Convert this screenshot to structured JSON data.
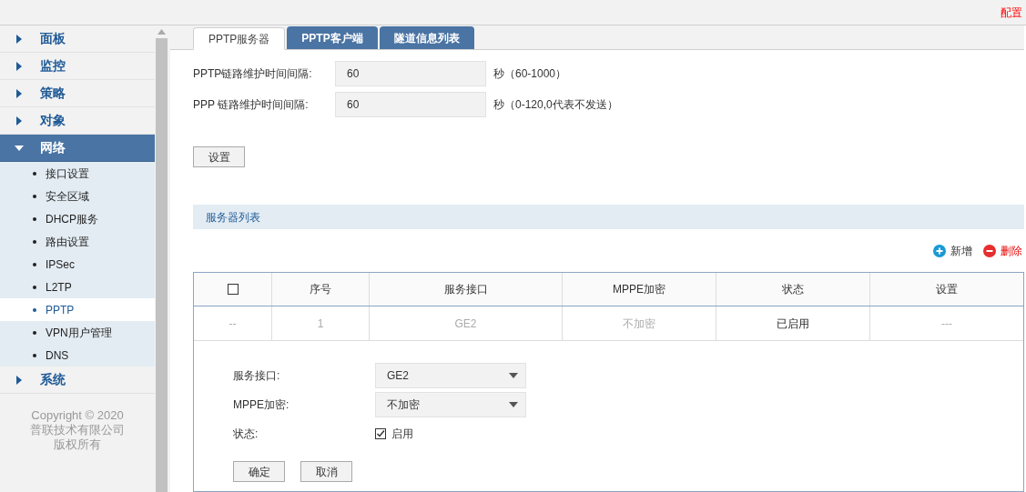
{
  "top_bar": {
    "link": "配置"
  },
  "sidebar": {
    "items": [
      {
        "label": "面板",
        "expanded": false
      },
      {
        "label": "监控",
        "expanded": false
      },
      {
        "label": "策略",
        "expanded": false
      },
      {
        "label": "对象",
        "expanded": false
      },
      {
        "label": "网络",
        "expanded": true,
        "children": [
          {
            "label": "接口设置",
            "selected": false
          },
          {
            "label": "安全区域",
            "selected": false
          },
          {
            "label": "DHCP服务",
            "selected": false
          },
          {
            "label": "路由设置",
            "selected": false
          },
          {
            "label": "IPSec",
            "selected": false
          },
          {
            "label": "L2TP",
            "selected": false
          },
          {
            "label": "PPTP",
            "selected": true
          },
          {
            "label": "VPN用户管理",
            "selected": false
          },
          {
            "label": "DNS",
            "selected": false
          }
        ]
      },
      {
        "label": "系统",
        "expanded": false
      }
    ],
    "copyright": [
      "Copyright © 2020",
      "普联技术有限公司",
      "版权所有"
    ]
  },
  "tabs": [
    {
      "label": "PPTP服务器",
      "selected": true
    },
    {
      "label": "PPTP客户端",
      "selected": false
    },
    {
      "label": "隧道信息列表",
      "selected": false
    }
  ],
  "settings": {
    "fields": [
      {
        "label": "PPTP链路维护时间间隔:",
        "value": "60",
        "hint": "秒（60-1000）"
      },
      {
        "label": "PPP 链路维护时间间隔:",
        "value": "60",
        "hint": "秒（0-120,0代表不发送）"
      }
    ],
    "button": "设置"
  },
  "server_list": {
    "title": "服务器列表",
    "add": "新增",
    "delete": "删除",
    "columns": [
      {
        "kind": "checkbox",
        "checked": false
      },
      {
        "kind": "text",
        "label": "序号"
      },
      {
        "kind": "text",
        "label": "服务接口"
      },
      {
        "kind": "text",
        "label": "MPPE加密"
      },
      {
        "kind": "text",
        "label": "状态"
      },
      {
        "kind": "text",
        "label": "设置"
      }
    ],
    "rows": [
      {
        "cells": [
          "--",
          "1",
          "GE2",
          "不加密",
          "已启用",
          "---"
        ]
      }
    ],
    "editor": {
      "fields": [
        {
          "kind": "select",
          "label": "服务接口:",
          "value": "GE2"
        },
        {
          "kind": "select",
          "label": "MPPE加密:",
          "value": "不加密"
        },
        {
          "kind": "checkbox",
          "label": "状态:",
          "option": "启用",
          "checked": true
        }
      ],
      "buttons": [
        "确定",
        "取消"
      ]
    }
  }
}
